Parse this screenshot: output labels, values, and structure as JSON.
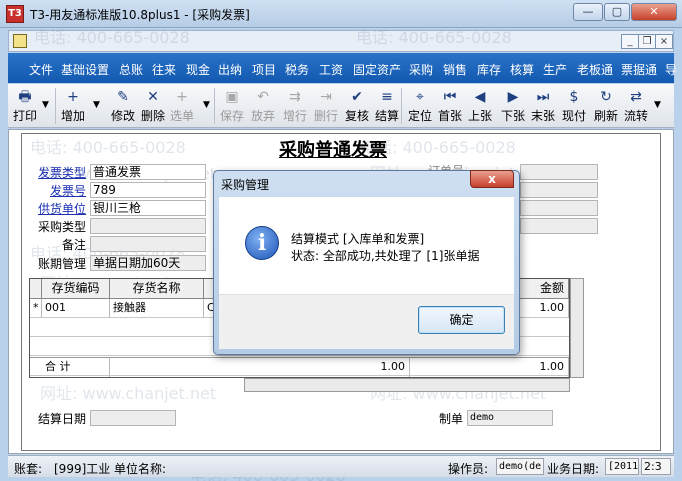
{
  "window": {
    "title": "T3-用友通标准版10.8plus1 - [采购发票]",
    "app_icon": "T3",
    "min": "0",
    "max": "1",
    "close": "r"
  },
  "mdi": {
    "min": "_",
    "restore": "❐",
    "close": "×"
  },
  "menu": [
    "文件",
    "基础设置",
    "总账",
    "往来",
    "现金",
    "出纳",
    "项目",
    "税务",
    "工资",
    "固定资产",
    "采购",
    "销售",
    "库存",
    "核算",
    "生产",
    "老板通",
    "票据通",
    "导"
  ],
  "toolbar": [
    {
      "label": "打印",
      "icon": "🖶",
      "enabled": true
    },
    {
      "label": "增加",
      "icon": "+",
      "enabled": true
    },
    {
      "label": "修改",
      "icon": "✎",
      "enabled": true
    },
    {
      "label": "删除",
      "icon": "✕",
      "enabled": true
    },
    {
      "label": "选单",
      "icon": "+",
      "enabled": false
    },
    {
      "label": "保存",
      "icon": "▣",
      "enabled": false
    },
    {
      "label": "放弃",
      "icon": "↶",
      "enabled": false
    },
    {
      "label": "增行",
      "icon": "⇉",
      "enabled": false
    },
    {
      "label": "删行",
      "icon": "⇥",
      "enabled": false
    },
    {
      "label": "复核",
      "icon": "✔",
      "enabled": true
    },
    {
      "label": "结算",
      "icon": "≡",
      "enabled": true
    },
    {
      "label": "定位",
      "icon": "⌖",
      "enabled": true
    },
    {
      "label": "首张",
      "icon": "⏮",
      "enabled": true
    },
    {
      "label": "上张",
      "icon": "◀",
      "enabled": true
    },
    {
      "label": "下张",
      "icon": "▶",
      "enabled": true
    },
    {
      "label": "末张",
      "icon": "⏭",
      "enabled": true
    },
    {
      "label": "现付",
      "icon": "$",
      "enabled": true
    },
    {
      "label": "刷新",
      "icon": "↻",
      "enabled": true
    },
    {
      "label": "流转",
      "icon": "⇄",
      "enabled": true
    }
  ],
  "document": {
    "title": "采购普通发票",
    "fields": {
      "invoice_type_label": "发票类型",
      "invoice_type_value": "普通发票",
      "invoice_no_label": "发票号",
      "invoice_no_value": "789",
      "supplier_label": "供货单位",
      "supplier_value": "银川三枪",
      "purchase_type_label": "采购类型",
      "remark_label": "备注",
      "payment_terms_label": "账期管理",
      "payment_terms_value": "单据日期加60天",
      "order_no_label": "订单号",
      "settle_date_label": "结算日期",
      "maker_label": "制单",
      "maker_value": "demo"
    },
    "grid": {
      "columns": [
        "",
        "存货编码",
        "存货名称",
        "",
        "金额"
      ],
      "rows": [
        {
          "marker": "*",
          "code": "001",
          "name": "接触器",
          "extra": "C",
          "amount": "1.00"
        }
      ],
      "total_label": "合 计",
      "total_values": [
        "1.00",
        "1.00"
      ]
    }
  },
  "watermark": {
    "phone": "电话: 400-665-0028",
    "site": "网址: www.chanjet.net"
  },
  "status": {
    "account_label": "账套:",
    "account_value": "[999]工业",
    "unit_label": "单位名称:",
    "operator_label": "操作员:",
    "operator_value": "demo(de",
    "bizdate_label": "业务日期:",
    "bizdate_value": "[2011",
    "page": "2:3"
  },
  "dialog": {
    "title": "采购管理",
    "close": "x",
    "line1": "结算模式 [入库单和发票]",
    "line2": "状态: 全部成功,共处理了 [1]张单据",
    "ok": "确定"
  }
}
